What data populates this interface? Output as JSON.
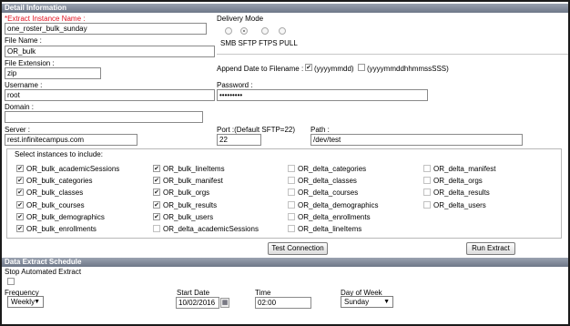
{
  "detail": {
    "header": "Detail Information",
    "extract_name_label": "*Extract Instance Name :",
    "extract_name_value": "one_roster_bulk_sunday",
    "file_name_label": "File Name :",
    "file_name_value": "OR_bulk",
    "file_ext_label": "File Extension :",
    "file_ext_value": "zip",
    "username_label": "Username :",
    "username_value": "root",
    "domain_label": "Domain :",
    "domain_value": "",
    "server_label": "Server :",
    "server_value": "rest.infinitecampus.com",
    "delivery_mode_label": "Delivery Mode",
    "delivery_modes": "SMB SFTP FTPS PULL",
    "append_date_label": "Append Date to Filename :",
    "append_opt1": "(yyyymmdd)",
    "append_opt2": "(yyyymmddhhmmssSSS)",
    "password_label": "Password :",
    "password_value": "•••••••••",
    "port_label": "Port :(Default SFTP=22)",
    "port_value": "22",
    "path_label": "Path :",
    "path_value": "/dev/test"
  },
  "instances": {
    "legend": "Select instances to include:",
    "col1": [
      "OR_bulk_academicSessions",
      "OR_bulk_categories",
      "OR_bulk_classes",
      "OR_bulk_courses",
      "OR_bulk_demographics",
      "OR_bulk_enrollments"
    ],
    "col2": [
      "OR_bulk_lineItems",
      "OR_bulk_manifest",
      "OR_bulk_orgs",
      "OR_bulk_results",
      "OR_bulk_users",
      "OR_delta_academicSessions"
    ],
    "col3": [
      "OR_delta_categories",
      "OR_delta_classes",
      "OR_delta_courses",
      "OR_delta_demographics",
      "OR_delta_enrollments",
      "OR_delta_lineItems"
    ],
    "col4": [
      "OR_delta_manifest",
      "OR_delta_orgs",
      "OR_delta_results",
      "OR_delta_users"
    ],
    "checked_col1": [
      true,
      true,
      true,
      true,
      true,
      true
    ],
    "checked_col2": [
      true,
      true,
      true,
      true,
      true,
      false
    ],
    "checked_col3": [
      false,
      false,
      false,
      false,
      false,
      false
    ],
    "checked_col4": [
      false,
      false,
      false,
      false
    ]
  },
  "actions": {
    "test_connection": "Test Connection",
    "run_extract": "Run Extract"
  },
  "schedule": {
    "header": "Data Extract Schedule",
    "stop_label": "Stop Automated Extract",
    "frequency_label": "Frequency",
    "frequency_value": "Weekly",
    "start_date_label": "Start Date",
    "start_date_value": "10/02/2016",
    "time_label": "Time",
    "time_value": "02:00",
    "day_label": "Day of Week",
    "day_value": "Sunday"
  }
}
